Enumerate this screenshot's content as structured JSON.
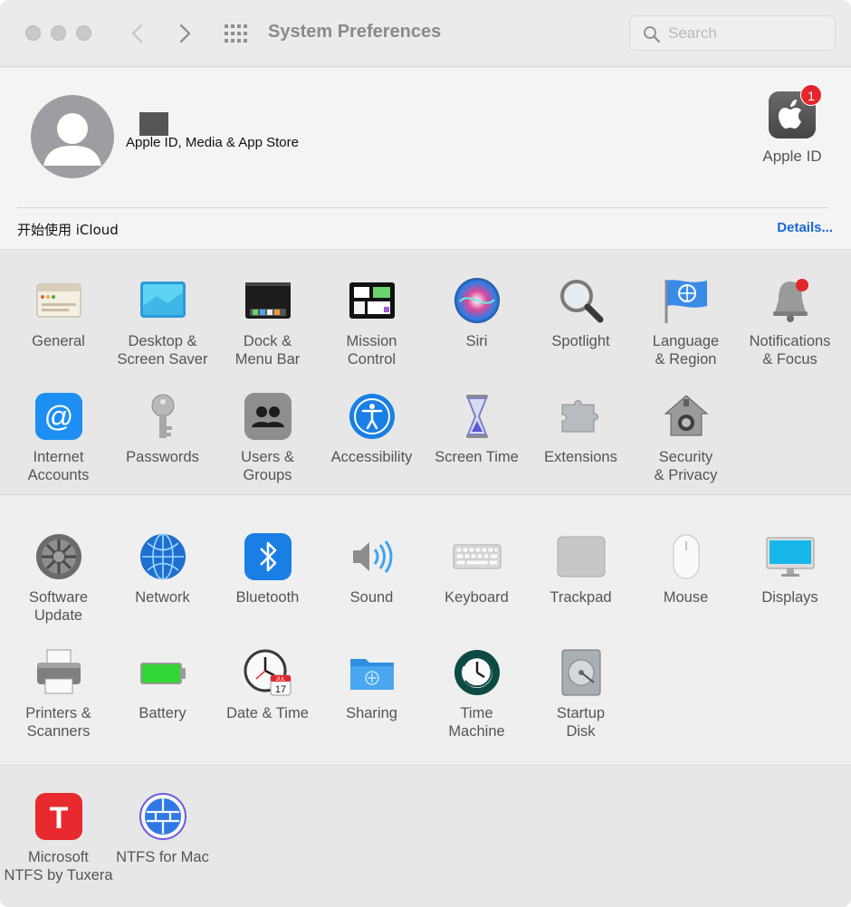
{
  "window": {
    "title": "System Preferences"
  },
  "search": {
    "placeholder": "Search"
  },
  "account": {
    "subtitle": "Apple ID, Media & App Store",
    "apple_id_label": "Apple ID",
    "apple_id_badge": "1",
    "icloud_prompt": "开始使用 iCloud",
    "details_link": "Details..."
  },
  "colors": {
    "accent_link": "#1a66d6",
    "badge_red": "#e3262b",
    "window_bg": "#ececec"
  },
  "sections": [
    {
      "panes": [
        {
          "id": "general",
          "label1": "General",
          "label2": "",
          "icon": "general-icon"
        },
        {
          "id": "desktop",
          "label1": "Desktop &",
          "label2": "Screen Saver",
          "icon": "desktop-screensaver-icon"
        },
        {
          "id": "dock",
          "label1": "Dock &",
          "label2": "Menu Bar",
          "icon": "dock-menubar-icon"
        },
        {
          "id": "mission",
          "label1": "Mission",
          "label2": "Control",
          "icon": "mission-control-icon"
        },
        {
          "id": "siri",
          "label1": "Siri",
          "label2": "",
          "icon": "siri-icon"
        },
        {
          "id": "spotlight",
          "label1": "Spotlight",
          "label2": "",
          "icon": "spotlight-icon"
        },
        {
          "id": "language",
          "label1": "Language",
          "label2": "& Region",
          "icon": "language-region-icon"
        },
        {
          "id": "notifications",
          "label1": "Notifications",
          "label2": "& Focus",
          "icon": "notifications-icon"
        },
        {
          "id": "internet",
          "label1": "Internet",
          "label2": "Accounts",
          "icon": "internet-accounts-icon"
        },
        {
          "id": "passwords",
          "label1": "Passwords",
          "label2": "",
          "icon": "passwords-icon"
        },
        {
          "id": "users",
          "label1": "Users &",
          "label2": "Groups",
          "icon": "users-groups-icon"
        },
        {
          "id": "accessibility",
          "label1": "Accessibility",
          "label2": "",
          "icon": "accessibility-icon"
        },
        {
          "id": "screentime",
          "label1": "Screen Time",
          "label2": "",
          "icon": "screen-time-icon"
        },
        {
          "id": "extensions",
          "label1": "Extensions",
          "label2": "",
          "icon": "extensions-icon"
        },
        {
          "id": "security",
          "label1": "Security",
          "label2": "& Privacy",
          "icon": "security-privacy-icon"
        }
      ]
    },
    {
      "panes": [
        {
          "id": "swupdate",
          "label1": "Software",
          "label2": "Update",
          "icon": "software-update-icon"
        },
        {
          "id": "network",
          "label1": "Network",
          "label2": "",
          "icon": "network-icon"
        },
        {
          "id": "bluetooth",
          "label1": "Bluetooth",
          "label2": "",
          "icon": "bluetooth-icon"
        },
        {
          "id": "sound",
          "label1": "Sound",
          "label2": "",
          "icon": "sound-icon"
        },
        {
          "id": "keyboard",
          "label1": "Keyboard",
          "label2": "",
          "icon": "keyboard-icon"
        },
        {
          "id": "trackpad",
          "label1": "Trackpad",
          "label2": "",
          "icon": "trackpad-icon"
        },
        {
          "id": "mouse",
          "label1": "Mouse",
          "label2": "",
          "icon": "mouse-icon"
        },
        {
          "id": "displays",
          "label1": "Displays",
          "label2": "",
          "icon": "displays-icon"
        },
        {
          "id": "printers",
          "label1": "Printers &",
          "label2": "Scanners",
          "icon": "printers-scanners-icon"
        },
        {
          "id": "battery",
          "label1": "Battery",
          "label2": "",
          "icon": "battery-icon"
        },
        {
          "id": "datetime",
          "label1": "Date & Time",
          "label2": "",
          "icon": "date-time-icon",
          "calendar_month": "JUL",
          "calendar_day": "17"
        },
        {
          "id": "sharing",
          "label1": "Sharing",
          "label2": "",
          "icon": "sharing-icon"
        },
        {
          "id": "timemachine",
          "label1": "Time",
          "label2": "Machine",
          "icon": "time-machine-icon"
        },
        {
          "id": "startup",
          "label1": "Startup",
          "label2": "Disk",
          "icon": "startup-disk-icon"
        }
      ]
    },
    {
      "panes": [
        {
          "id": "tuxera",
          "label1": "Microsoft",
          "label2": "NTFS by Tuxera",
          "icon": "tuxera-ntfs-icon",
          "glyph": "T"
        },
        {
          "id": "ntfsmac",
          "label1": "NTFS for Mac",
          "label2": "",
          "icon": "ntfs-for-mac-icon"
        }
      ]
    }
  ]
}
